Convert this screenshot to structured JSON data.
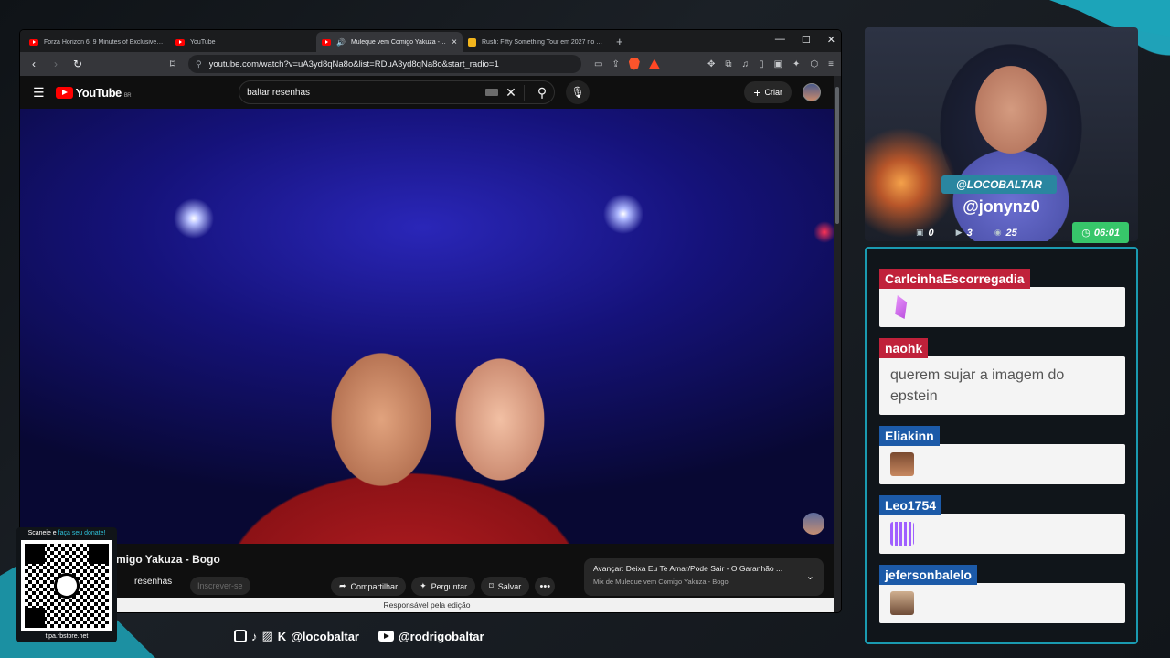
{
  "browser": {
    "tabs": [
      {
        "title": "Forza Horizon 6: 9 Minutes of Exclusive Scene",
        "favicon": "youtube-icon",
        "active": false
      },
      {
        "title": "YouTube",
        "favicon": "youtube-icon",
        "active": false
      },
      {
        "title": "Muleque vem Comigo Yakuza - Bogo",
        "favicon": "youtube-icon",
        "active": true
      },
      {
        "title": "Rush: Fifty Something Tour em 2027 no Brasil",
        "favicon": "rush-icon",
        "active": false
      }
    ],
    "url": "youtube.com/watch?v=uA3yd8qNa8o&list=RDuA3yd8qNa8o&start_radio=1",
    "badge_count": "1"
  },
  "youtube": {
    "logo_text": "YouTube",
    "country_code": "BR",
    "search_query": "baltar resenhas",
    "create_label": "Criar",
    "video_title": "migo Yakuza - Bogo",
    "channel_name": "resenhas",
    "subscribe_label": "Inscrever-se",
    "actions": {
      "share": "Compartilhar",
      "ask": "Perguntar",
      "save": "Salvar"
    },
    "next": {
      "title": "Avançar: Deixa Eu Te Amar/Pode Sair - O Garanhão ...",
      "subtitle": "Mix de Muleque vem Comigo Yakuza - Bogo"
    },
    "edit_bar": "Responsável pela edição"
  },
  "stream": {
    "webcam_tag": "@LOCOBALTAR",
    "current_user": "@jonynz0",
    "stats": {
      "chat": "0",
      "youtube": "3",
      "viewers": "25",
      "timer": "06:01"
    },
    "accent": "#1a9ab0",
    "timer_color": "#37c66a"
  },
  "chat": [
    {
      "user": "CarlcinhaEscorregadia",
      "color": "red",
      "text": "",
      "emote": "pink"
    },
    {
      "user": "naohk",
      "color": "red",
      "text": "querem sujar a imagem do epstein",
      "emote": ""
    },
    {
      "user": "Eliakinn",
      "color": "blue",
      "text": "",
      "emote": "face"
    },
    {
      "user": "Leo1754",
      "color": "blue",
      "text": "",
      "emote": "bars"
    },
    {
      "user": "jefersonbalelo",
      "color": "blue",
      "text": "",
      "emote": "face2"
    }
  ],
  "qr": {
    "top_prefix": "Scaneie e ",
    "top_link": "faça seu donate!",
    "url": "tipa.rbstore.net"
  },
  "socials": {
    "handle1": "@locobaltar",
    "handle2": "@rodrigobaltar"
  }
}
